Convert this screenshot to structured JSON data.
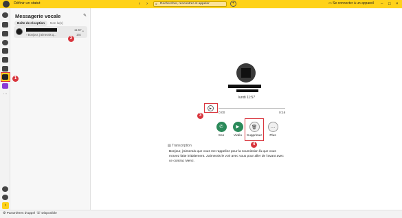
{
  "titlebar": {
    "status": "Définir un statut",
    "nav_back": "‹",
    "nav_forward": "›",
    "search_placeholder": "Rechercher, rencontrer et appeler",
    "plus": "+",
    "connect_label": "Se connecter à un appareil",
    "minimize": "–",
    "maximize": "□",
    "close": "×"
  },
  "list_pane": {
    "title": "Messagerie vocale",
    "tabs": [
      "Boîte de réception",
      "Non lu(s)"
    ],
    "items": [
      {
        "time": "11:57",
        "preview": "Bonjour, j'aimerais q...",
        "duration": "16s"
      }
    ]
  },
  "detail": {
    "date": "lundi 11:57",
    "player": {
      "start": "0:00",
      "end": "0:16"
    },
    "actions": [
      "Son",
      "Vidéo",
      "Supprimer",
      "Plus"
    ],
    "transcription_label": "Transcription",
    "transcription": "Bonjour, j'aimerais que vous me rappeliez pour la soumission là que vous m'avez faite initialement. J'aimerais le voir avec vous pour aller de l'avant avec ce contrat. Merci."
  },
  "statusbar": {
    "call_settings": "Paramètres d'appel",
    "availability": "Disponible"
  },
  "callouts": [
    "1",
    "2",
    "3",
    "4"
  ],
  "colors": {
    "accent": "#ffd219",
    "call_green": "#2b8a5a",
    "callout_red": "#d9363e"
  }
}
